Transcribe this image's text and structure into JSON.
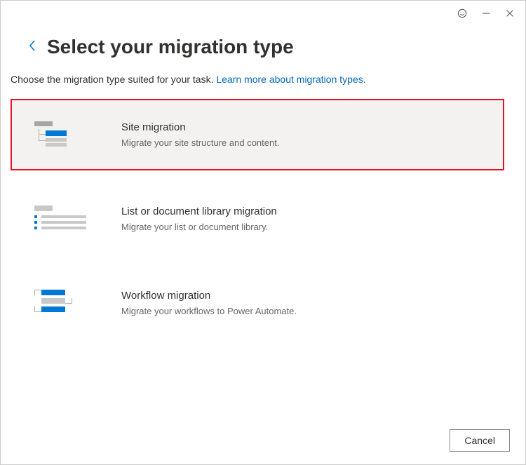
{
  "titlebar": {
    "feedback_icon": "smiley-icon",
    "minimize_icon": "minimize-icon",
    "close_icon": "close-icon"
  },
  "header": {
    "back_icon": "chevron-left-icon",
    "title": "Select your migration type"
  },
  "subtitle": {
    "text": "Choose the migration type suited for your task. ",
    "link": "Learn more about migration types."
  },
  "options": [
    {
      "title": "Site migration",
      "desc": "Migrate your site structure and content.",
      "selected": true,
      "icon": "site-structure-icon"
    },
    {
      "title": "List or document library migration",
      "desc": "Migrate your list or document library.",
      "selected": false,
      "icon": "list-library-icon"
    },
    {
      "title": "Workflow migration",
      "desc": "Migrate your workflows to Power Automate.",
      "selected": false,
      "icon": "workflow-icon"
    }
  ],
  "footer": {
    "cancel": "Cancel"
  },
  "colors": {
    "accent": "#0078d4",
    "highlight_border": "#e81123",
    "selected_bg": "#f3f2f1"
  }
}
